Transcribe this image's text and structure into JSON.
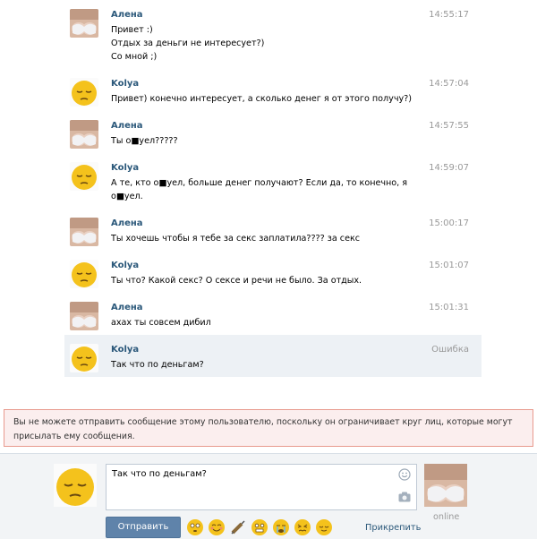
{
  "messages": [
    {
      "author": "Алена",
      "time": "14:55:17",
      "text": "Привет :)\nОтдых за деньги не интересует?)\nСо мной ;)",
      "who": "alena"
    },
    {
      "author": "Kolya",
      "time": "14:57:04",
      "text": "Привет) конечно интересует, а сколько денег я от этого получу?)",
      "who": "kolya"
    },
    {
      "author": "Алена",
      "time": "14:57:55",
      "text": "Ты о■уел?????",
      "who": "alena"
    },
    {
      "author": "Kolya",
      "time": "14:59:07",
      "text": "А те, кто о■уел, больше денег получают? Если да, то конечно, я\nо■уел.",
      "who": "kolya"
    },
    {
      "author": "Алена",
      "time": "15:00:17",
      "text": "Ты хочешь чтобы я тебе за секс заплатила???? за секс",
      "who": "alena"
    },
    {
      "author": "Kolya",
      "time": "15:01:07",
      "text": "Ты что? Какой секс? О сексе и речи не было. За отдых.",
      "who": "kolya"
    },
    {
      "author": "Алена",
      "time": "15:01:31",
      "text": "ахах ты совсем дибил",
      "who": "alena"
    },
    {
      "author": "Kolya",
      "time": "Ошибка",
      "text": "Так что по деньгам?",
      "who": "kolya"
    }
  ],
  "error": {
    "text": "Вы не можете отправить сообщение этому пользователю, поскольку он ограничивает круг лиц, которые могут присылать ему сообщения."
  },
  "compose": {
    "draft": "Так что по деньгам?",
    "send_label": "Отправить",
    "attach_label": "Прикрепить",
    "status": "online"
  },
  "icons": {
    "smile": "smile-icon",
    "camera": "camera-icon",
    "emojis": [
      "flushed-emoji",
      "blush-emoji",
      "syringe-emoji",
      "grimace-emoji",
      "sob-emoji",
      "confounded-emoji",
      "relieved-emoji"
    ]
  },
  "colors": {
    "author": "#2b587a",
    "selected_row": "#edf1f5",
    "send_button": "#5f83aa",
    "error_bg": "#fbeeee",
    "error_border": "#e89a8e"
  }
}
